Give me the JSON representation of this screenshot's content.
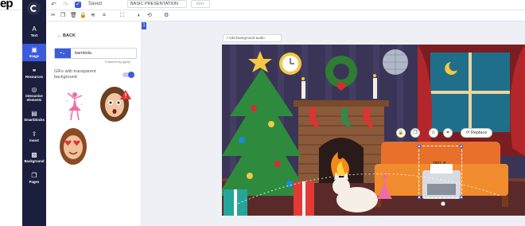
{
  "app": {
    "brand_fragment": "ep",
    "saved_label": "Saved",
    "title_value": "BASIC PRESENTATION",
    "edit_button": "EDIT"
  },
  "topbar_icons": [
    "undo-icon",
    "redo-icon",
    "saved-check-icon"
  ],
  "toolbar2_icons": [
    "cut-icon",
    "copy-icon",
    "delete-icon",
    "lock-icon",
    "layers-icon",
    "crop-icon",
    "fit-icon",
    "color-icon",
    "flip-icon",
    "position-icon"
  ],
  "nav": [
    {
      "label": "Text",
      "icon": "text-icon"
    },
    {
      "label": "Image",
      "icon": "image-icon",
      "active": true
    },
    {
      "label": "Resources",
      "icon": "resources-icon"
    },
    {
      "label": "Interactive elements",
      "icon": "interactive-icon"
    },
    {
      "label": "Smartblocks",
      "icon": "smartblocks-icon"
    },
    {
      "label": "Insert",
      "icon": "insert-icon"
    },
    {
      "label": "Background",
      "icon": "background-icon"
    },
    {
      "label": "Pages",
      "icon": "pages-icon"
    }
  ],
  "panel": {
    "back_label": "BACK",
    "search_value": "bambola",
    "powered_by": "Powered by giphy",
    "gif_transparent_label": "GIFs with transparent background",
    "toggle_on": true,
    "results": [
      "pink-ballerina-gif",
      "surprised-girl-gif",
      "heart-eyes-girl-gif"
    ]
  },
  "canvas": {
    "page_number": "1",
    "add_audio_label": "+ Add background audio",
    "replace_label": "Replace",
    "typewriter_text": "TEST M",
    "overlay_icons": [
      "lock-icon",
      "duplicate-icon",
      "animation-icon",
      "link-icon"
    ]
  },
  "colors": {
    "nav_bg": "#1b1e3d",
    "accent": "#3b5bdb",
    "slide_bg": "#3a3556"
  }
}
